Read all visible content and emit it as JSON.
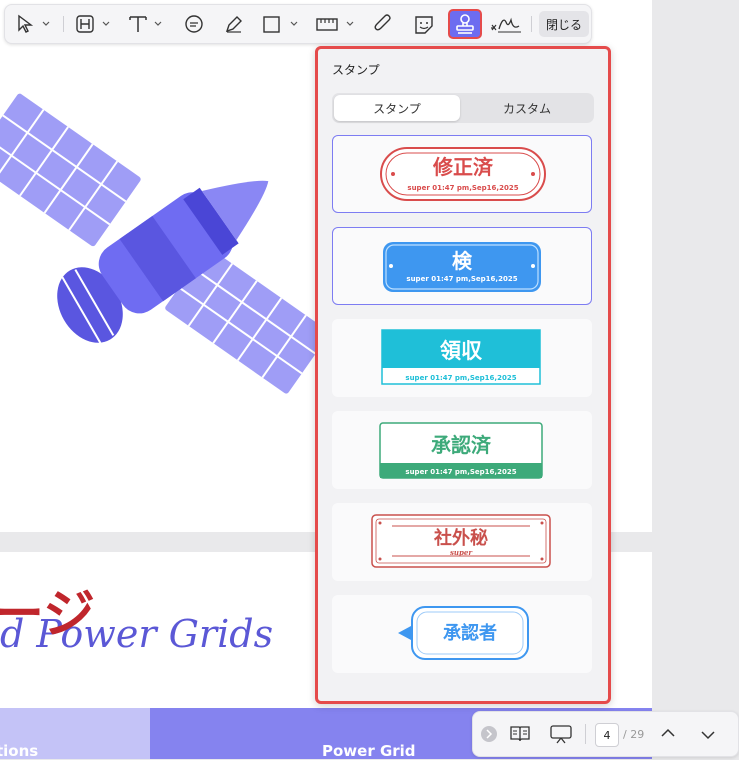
{
  "toolbar": {
    "tools": [
      "select-tool",
      "heading-tool",
      "text-tool",
      "comment-tool",
      "highlight-tool",
      "shape-tool",
      "measure-tool",
      "attach-tool",
      "sticker-tool",
      "stamp-tool",
      "signature-tool"
    ],
    "close_label": "閉じる"
  },
  "stamp_panel": {
    "title": "スタンプ",
    "tabs": [
      "スタンプ",
      "カスタム"
    ],
    "selected_tab": "スタンプ",
    "stamps": [
      {
        "text": "修正済",
        "subtext": "super 01:47 pm,Sep16,2025",
        "color": "#d94c4c"
      },
      {
        "text": "検",
        "subtext": "super 01:47 pm,Sep16,2025",
        "color": "#3e97f0"
      },
      {
        "text": "領収",
        "subtext": "super 01:47 pm,Sep16,2025",
        "color": "#1fbfd8"
      },
      {
        "text": "承認済",
        "subtext": "super 01:47 pm,Sep16,2025",
        "color": "#3daa7a"
      },
      {
        "text": "社外秘",
        "subtext": "super",
        "color": "#c9504c"
      },
      {
        "text": "承認者",
        "subtext": "",
        "color": "#3e97f0"
      }
    ]
  },
  "document": {
    "heading_fragment": "d Power Grids",
    "overlay_text": "ージ",
    "band_left": "tions",
    "band_right": "Power Grid"
  },
  "page_nav": {
    "current_page": "4",
    "total_pages": "/ 29"
  }
}
